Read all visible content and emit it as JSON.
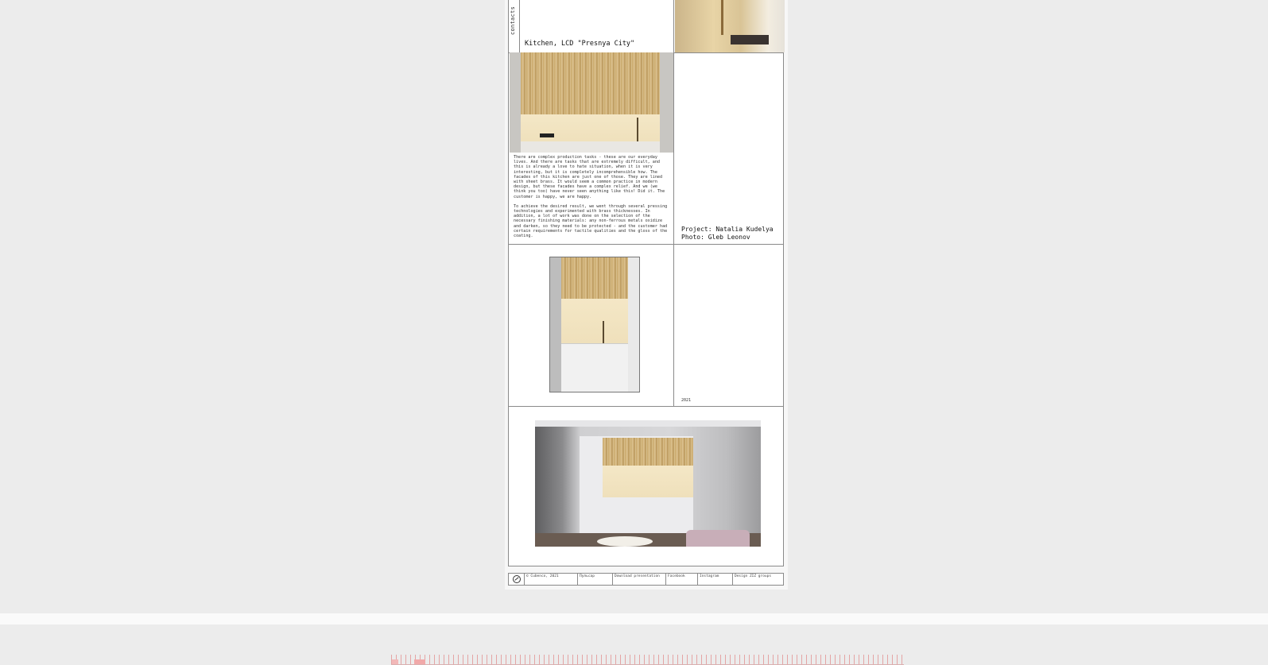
{
  "sidebar": {
    "contacts_label": "contacts"
  },
  "project": {
    "title": "Kitchen, LCD \"Presnya City\"",
    "description_p1": "There are complex production tasks - these are our everyday lives. And there are tasks that are extremely difficult, and this is already a love to hate situation, when it is very interesting, but it is completely incomprehensible how. The facades of this kitchen are just one of those. They are lined with sheet brass. It would seem a common practice in modern design, but these facades have a complex relief. And we (we think you too) have never seen anything like this! Did it. The customer is happy, we are happy.",
    "description_p2": "To achieve the desired result, we went through several pressing technologies and experimented with brass thicknesses. In addition, a lot of work was done on the selection of the necessary finishing materials: any non-ferrous metals oxidize and darken, so they need to be protected - and the customer had certain requirements for tactile qualities and the gloss of the coating.",
    "credit_project": "Project: Natalia Kudelya",
    "credit_photo": "Photo: Gleb Leonov",
    "year": "2021"
  },
  "footer": {
    "copyright": "© Cubenco, 2021",
    "col2": "Пульсар",
    "col3": "Download presentation",
    "col4": "Facebook",
    "col5": "Instagram",
    "col6": "Design ZIZ groups"
  },
  "colors": {
    "background": "#ececec",
    "grid_line": "#8a8a8a",
    "brass": "#c9a86a"
  }
}
